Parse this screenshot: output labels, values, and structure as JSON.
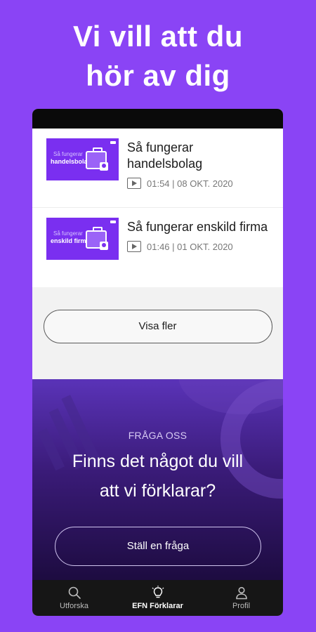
{
  "headline": {
    "line1": "Vi vill att du",
    "line2": "hör av dig"
  },
  "videos": [
    {
      "title": "Så fungerar handelsbolag",
      "duration": "01:54",
      "date": "08 OKT. 2020",
      "thumb_line1": "Så fungerar",
      "thumb_line2": "handelsbolag"
    },
    {
      "title": "Så fungerar enskild firma",
      "duration": "01:46",
      "date": "01 OKT. 2020",
      "thumb_line1": "Så fungerar",
      "thumb_line2": "enskild firma"
    }
  ],
  "more_button_label": "Visa fler",
  "ask": {
    "label": "FRÅGA OSS",
    "question_line1": "Finns det något du vill",
    "question_line2": "att vi förklarar?",
    "button_label": "Ställ en fråga"
  },
  "tabs": [
    {
      "label": "Utforska",
      "icon": "search-icon",
      "active": false
    },
    {
      "label": "EFN Förklarar",
      "icon": "lightbulb-icon",
      "active": true
    },
    {
      "label": "Profil",
      "icon": "person-icon",
      "active": false
    }
  ],
  "colors": {
    "background": "#8a44f5",
    "thumb_purple": "#7a2ff0",
    "tab_bar": "#161616"
  }
}
